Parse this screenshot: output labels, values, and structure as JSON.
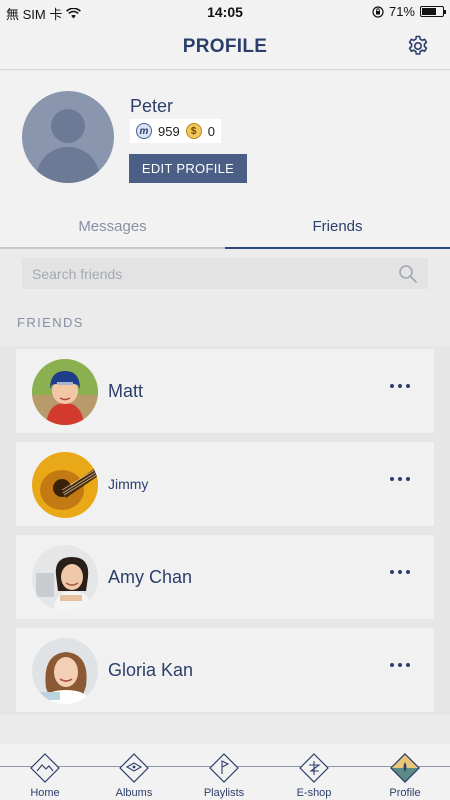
{
  "status_bar": {
    "carrier": "無 SIM 卡",
    "time": "14:05",
    "battery": "71%",
    "battery_level": 0.71
  },
  "header": {
    "title": "PROFILE",
    "settings_icon": "gear-icon"
  },
  "profile": {
    "name": "Peter",
    "points": "959",
    "coins": "0",
    "edit_label": "EDIT PROFILE"
  },
  "tabs": [
    {
      "label": "Messages",
      "active": false
    },
    {
      "label": "Friends",
      "active": true
    }
  ],
  "search": {
    "placeholder": "Search friends",
    "value": ""
  },
  "friends_section": {
    "label": "FRIENDS",
    "items": [
      {
        "name": "Matt"
      },
      {
        "name": "Jimmy"
      },
      {
        "name": "Amy Chan"
      },
      {
        "name": "Gloria Kan"
      }
    ]
  },
  "tabbar": {
    "items": [
      {
        "label": "Home",
        "icon": "home-icon",
        "active": false
      },
      {
        "label": "Albums",
        "icon": "albums-icon",
        "active": false
      },
      {
        "label": "Playlists",
        "icon": "playlists-icon",
        "active": false
      },
      {
        "label": "E-shop",
        "icon": "eshop-icon",
        "active": false
      },
      {
        "label": "Profile",
        "icon": "profile-icon",
        "active": true
      }
    ]
  },
  "colors": {
    "brand": "#2c3f6b",
    "button": "#4b5e85",
    "active_tab_underline": "#2c4a7e",
    "muted": "#8791a6"
  }
}
